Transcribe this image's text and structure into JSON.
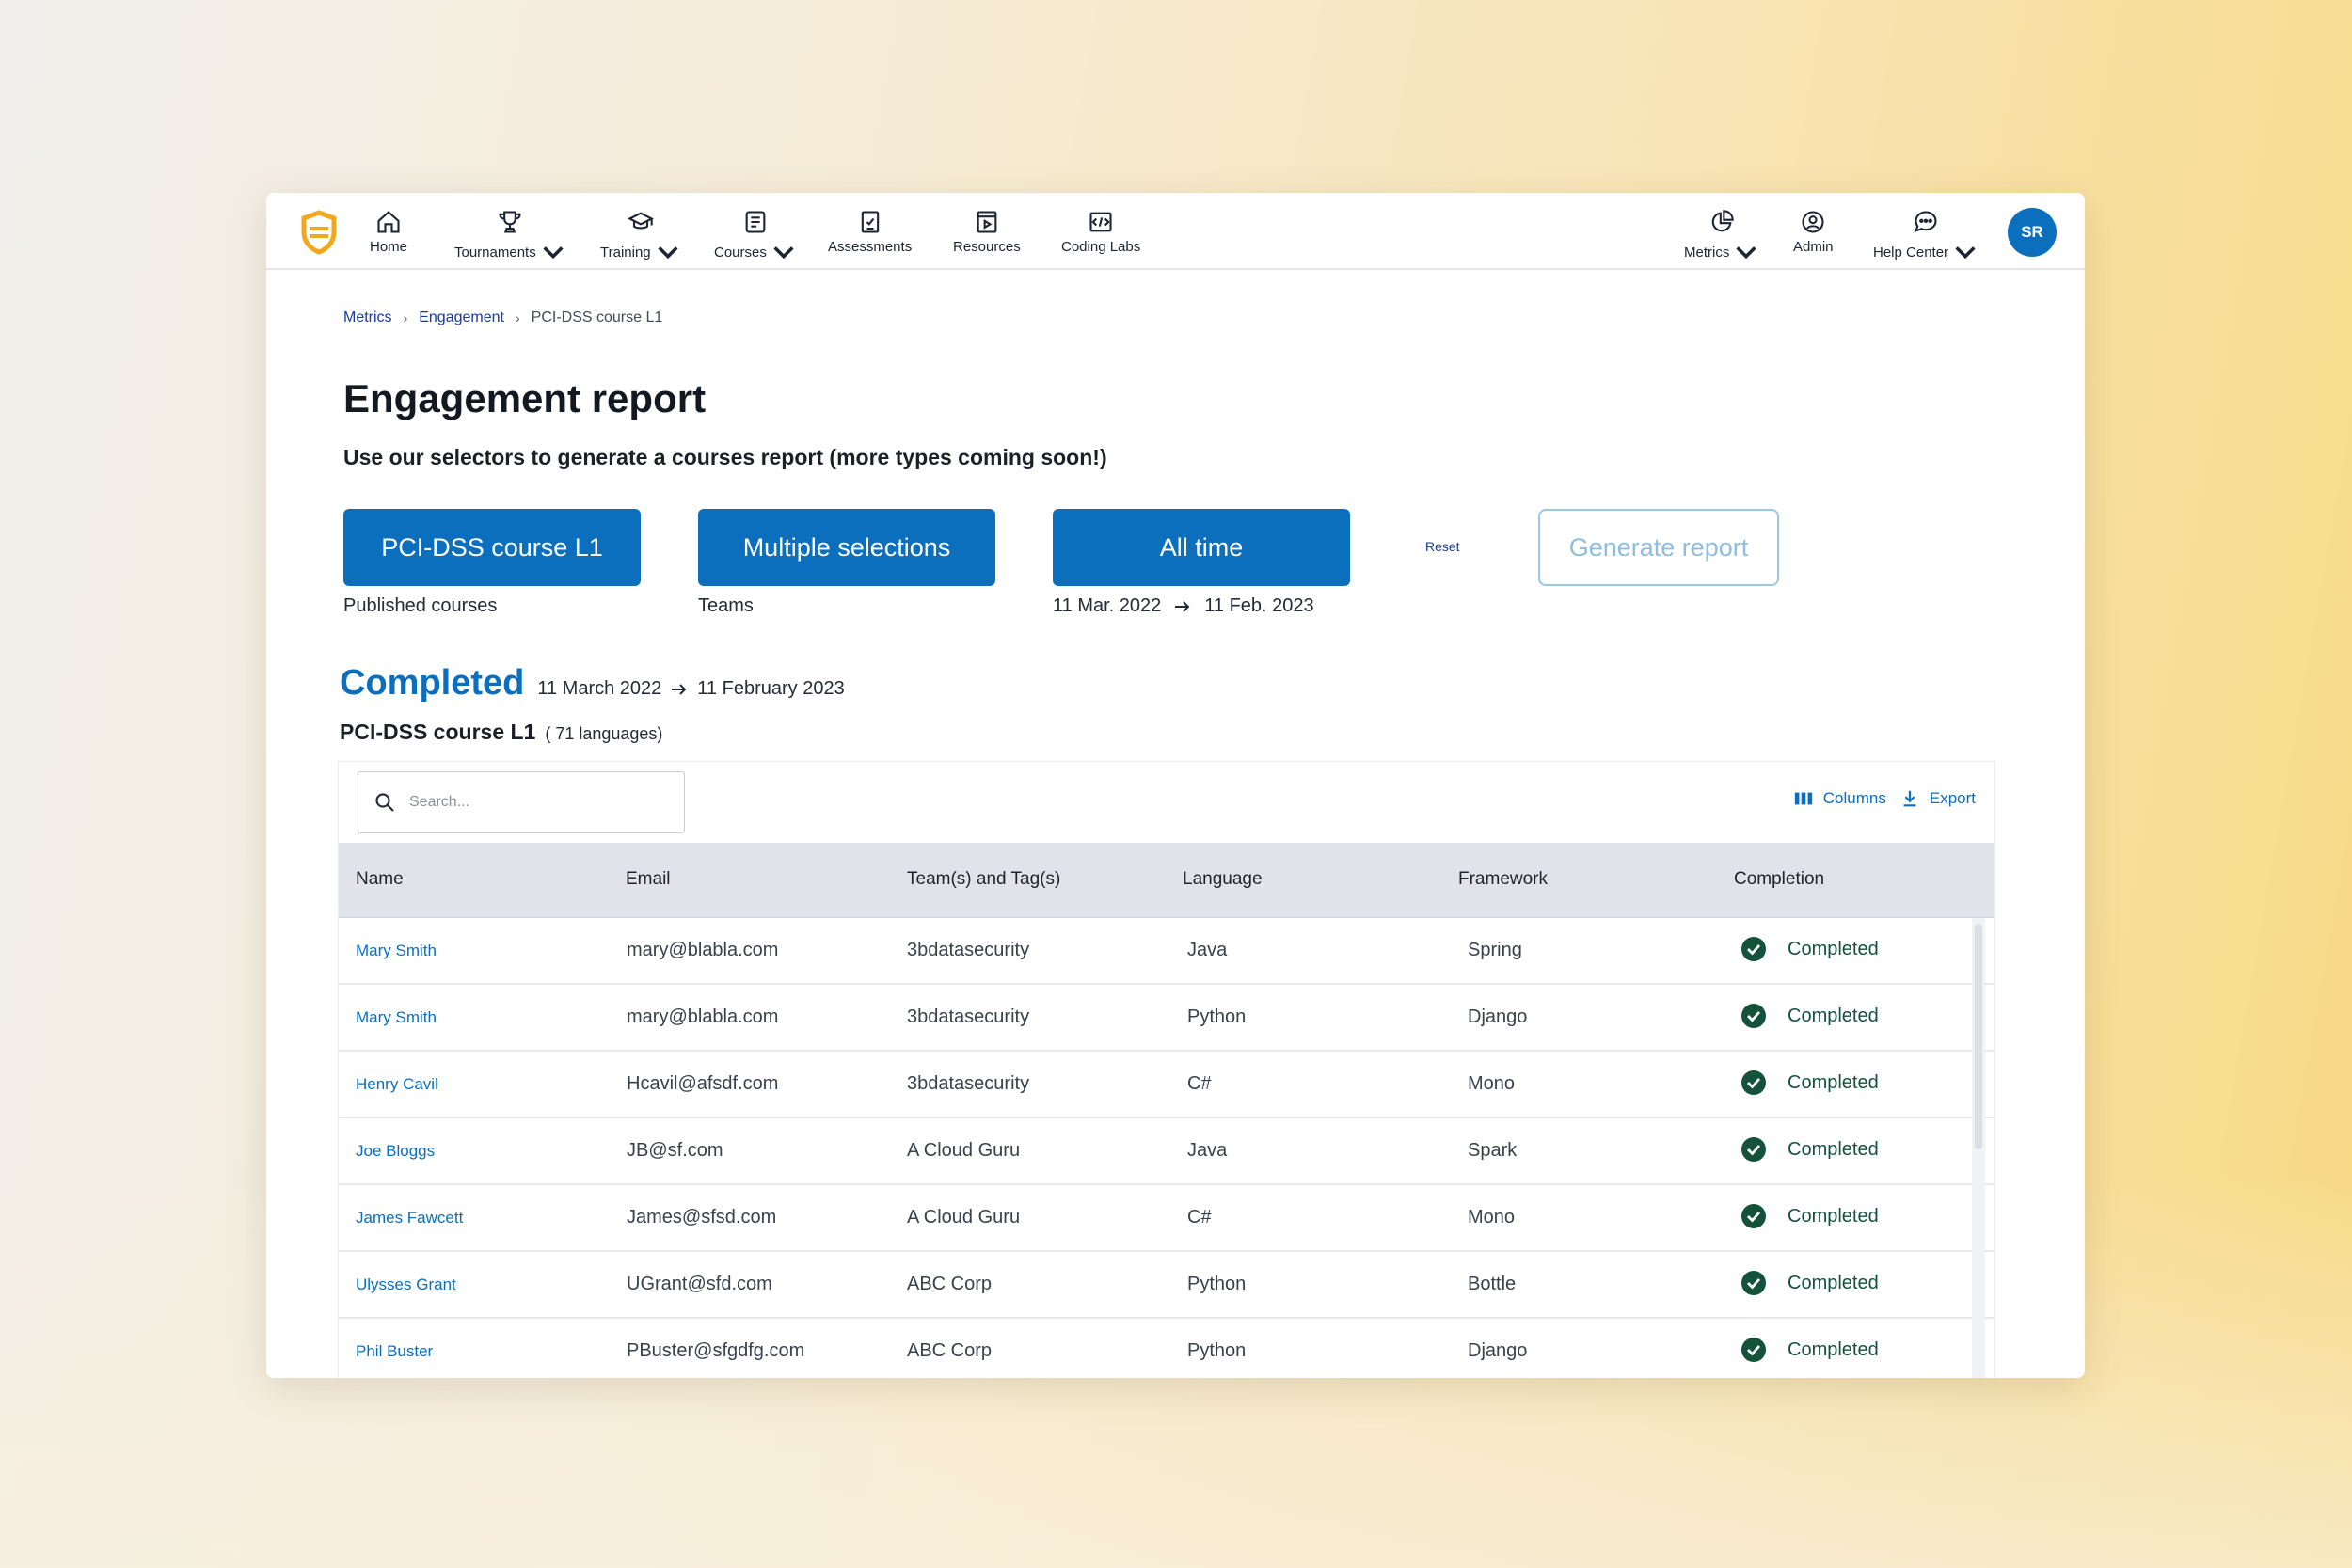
{
  "nav": {
    "items": [
      {
        "label": "Home",
        "icon": "home-icon",
        "dropdown": false
      },
      {
        "label": "Tournaments",
        "icon": "trophy-icon",
        "dropdown": true
      },
      {
        "label": "Training",
        "icon": "graduation-cap-icon",
        "dropdown": true
      },
      {
        "label": "Courses",
        "icon": "book-icon",
        "dropdown": true
      },
      {
        "label": "Assessments",
        "icon": "checklist-icon",
        "dropdown": false
      },
      {
        "label": "Resources",
        "icon": "video-file-icon",
        "dropdown": false
      },
      {
        "label": "Coding Labs",
        "icon": "code-lab-icon",
        "dropdown": false
      }
    ],
    "right_items": [
      {
        "label": "Metrics",
        "icon": "pie-chart-icon",
        "dropdown": true
      },
      {
        "label": "Admin",
        "icon": "admin-icon",
        "dropdown": false
      },
      {
        "label": "Help Center",
        "icon": "chat-icon",
        "dropdown": true
      }
    ],
    "avatar_initials": "SR",
    "brand_color": "#0b6fbd"
  },
  "breadcrumb": {
    "items": [
      "Metrics",
      "Engagement"
    ],
    "current": "PCI-DSS course L1"
  },
  "page": {
    "title": "Engagement report",
    "subtitle": "Use our selectors to generate a courses report (more types coming soon!)"
  },
  "selectors": {
    "course": {
      "label": "PCI-DSS course L1",
      "caption": "Published courses"
    },
    "teams": {
      "label": "Multiple selections",
      "caption": "Teams"
    },
    "time": {
      "label": "All time",
      "from": "11 Mar. 2022",
      "to": "11 Feb. 2023"
    },
    "reset_label": "Reset",
    "generate_label": "Generate report"
  },
  "report": {
    "heading": "Completed",
    "from": "11 March 2022",
    "to": "11 February 2023",
    "course_name": "PCI-DSS course L1",
    "course_langs": "( 71 languages)"
  },
  "table": {
    "search_placeholder": "Search...",
    "columns_label": "Columns",
    "export_label": "Export",
    "headers": [
      "Name",
      "Email",
      "Team(s) and Tag(s)",
      "Language",
      "Framework",
      "Completion"
    ],
    "rows": [
      {
        "name": "Mary Smith",
        "email": "mary@blabla.com",
        "team": "3bdatasecurity",
        "language": "Java",
        "framework": "Spring",
        "status": "Completed"
      },
      {
        "name": "Mary Smith",
        "email": "mary@blabla.com",
        "team": "3bdatasecurity",
        "language": "Python",
        "framework": "Django",
        "status": "Completed"
      },
      {
        "name": "Henry Cavil",
        "email": "Hcavil@afsdf.com",
        "team": "3bdatasecurity",
        "language": "C#",
        "framework": "Mono",
        "status": "Completed"
      },
      {
        "name": "Joe Bloggs",
        "email": "JB@sf.com",
        "team": "A Cloud Guru",
        "language": "Java",
        "framework": "Spark",
        "status": "Completed"
      },
      {
        "name": "James Fawcett",
        "email": "James@sfsd.com",
        "team": "A Cloud Guru",
        "language": "C#",
        "framework": "Mono",
        "status": "Completed"
      },
      {
        "name": "Ulysses Grant",
        "email": "UGrant@sfd.com",
        "team": "ABC Corp",
        "language": "Python",
        "framework": "Bottle",
        "status": "Completed"
      },
      {
        "name": "Phil Buster",
        "email": "PBuster@sfgdfg.com",
        "team": "ABC Corp",
        "language": "Python",
        "framework": "Django",
        "status": "Completed"
      }
    ]
  }
}
